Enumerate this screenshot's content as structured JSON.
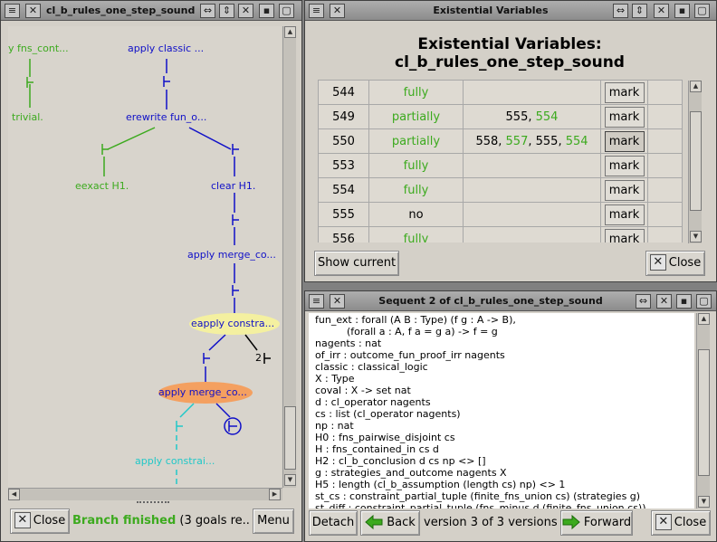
{
  "left_window": {
    "title": "cl_b_rules_one_step_sound proo",
    "tree_nodes": {
      "n1": "y fns_cont...",
      "n2": "apply classic ...",
      "n3": "trivial.",
      "n4": "erewrite fun_o...",
      "n5": "eexact H1.",
      "n6": "clear H1.",
      "n7": "apply merge_co...",
      "n8": "eapply constra...",
      "n9": "apply merge_co...",
      "n10": "apply constrai...",
      "goal_count": "2"
    },
    "close_label": "Close",
    "status_main": "Branch finished",
    "status_rest": " (3 goals re...",
    "menu_label": "Menu"
  },
  "ev_window": {
    "title": "Existential Variables",
    "heading_line1": "Existential Variables:",
    "heading_line2": "cl_b_rules_one_step_sound",
    "rows": [
      {
        "id": "544",
        "status": "fully",
        "deps": [],
        "mark": "mark"
      },
      {
        "id": "549",
        "status": "partially",
        "deps": [
          {
            "v": "555",
            "c": "black"
          },
          {
            "v": "554",
            "c": "green"
          }
        ],
        "mark": "mark"
      },
      {
        "id": "550",
        "status": "partially",
        "deps": [
          {
            "v": "558",
            "c": "black"
          },
          {
            "v": "557",
            "c": "green"
          },
          {
            "v": "555",
            "c": "black"
          },
          {
            "v": "554",
            "c": "green"
          }
        ],
        "mark": "mark"
      },
      {
        "id": "553",
        "status": "fully",
        "deps": [],
        "mark": "mark"
      },
      {
        "id": "554",
        "status": "fully",
        "deps": [],
        "mark": "mark"
      },
      {
        "id": "555",
        "status": "no",
        "deps": [],
        "mark": "mark"
      },
      {
        "id": "556",
        "status": "fully",
        "deps": [],
        "mark": "mark"
      }
    ],
    "show_current_label": "Show current",
    "close_label": "Close"
  },
  "seq_window": {
    "title": "Sequent 2 of cl_b_rules_one_step_sound",
    "lines": [
      "fun_ext : forall (A B : Type) (f g : A -> B),",
      "          (forall a : A, f a = g a) -> f = g",
      "nagents : nat",
      "of_irr : outcome_fun_proof_irr nagents",
      "classic : classical_logic",
      "X : Type",
      "coval : X -> set nat",
      "d : cl_operator nagents",
      "cs : list (cl_operator nagents)",
      "np : nat",
      "H0 : fns_pairwise_disjoint cs",
      "H : fns_contained_in cs d",
      "H2 : cl_b_conclusion d cs np <> []",
      "g : strategies_and_outcome nagents X",
      "H5 : length (cl_b_assumption (length cs) np) <> 1",
      "st_cs : constraint_partial_tuple (finite_fns_union cs) (strategies g)",
      "st_diff : constraint_partial_tuple (fns_minus d (finite_fns_union cs))"
    ],
    "detach_label": "Detach",
    "back_label": "Back",
    "version_label": "version 3 of 3 versions",
    "forward_label": "Forward",
    "close_label": "Close"
  },
  "colors": {
    "green": "#3caa1e",
    "blue": "#1010c8",
    "cyan": "#20c8c8",
    "yellow_node": "#f4f0a0",
    "orange_node": "#f4a060"
  }
}
